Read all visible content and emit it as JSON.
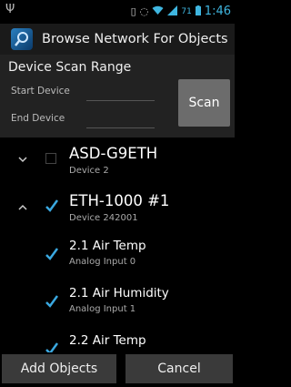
{
  "status_bar": {
    "usb_icon": "usb-icon",
    "battery_text": "71",
    "time": "1:46"
  },
  "action_bar": {
    "title": "Browse Network For Objects",
    "icon": "network-search-icon"
  },
  "scan_range": {
    "title": "Device Scan Range",
    "start_label": "Start Device",
    "end_label": "End Device",
    "start_value": "",
    "end_value": "",
    "scan_label": "Scan"
  },
  "devices": [
    {
      "name": "ASD-G9ETH",
      "sub": "Device 2",
      "expanded": false,
      "checked": false
    },
    {
      "name": "ETH-1000 #1",
      "sub": "Device 242001",
      "expanded": true,
      "checked": true
    }
  ],
  "objects": [
    {
      "name": "2.1 Air Temp",
      "sub": "Analog Input 0",
      "checked": true
    },
    {
      "name": "2.1 Air Humidity",
      "sub": "Analog Input 1",
      "checked": true
    },
    {
      "name": "2.2 Air Temp",
      "sub": "",
      "checked": true
    }
  ],
  "buttons": {
    "add_objects": "Add Objects",
    "cancel": "Cancel"
  },
  "colors": {
    "accent": "#3aa8e0",
    "check": "#3aa8e0"
  }
}
